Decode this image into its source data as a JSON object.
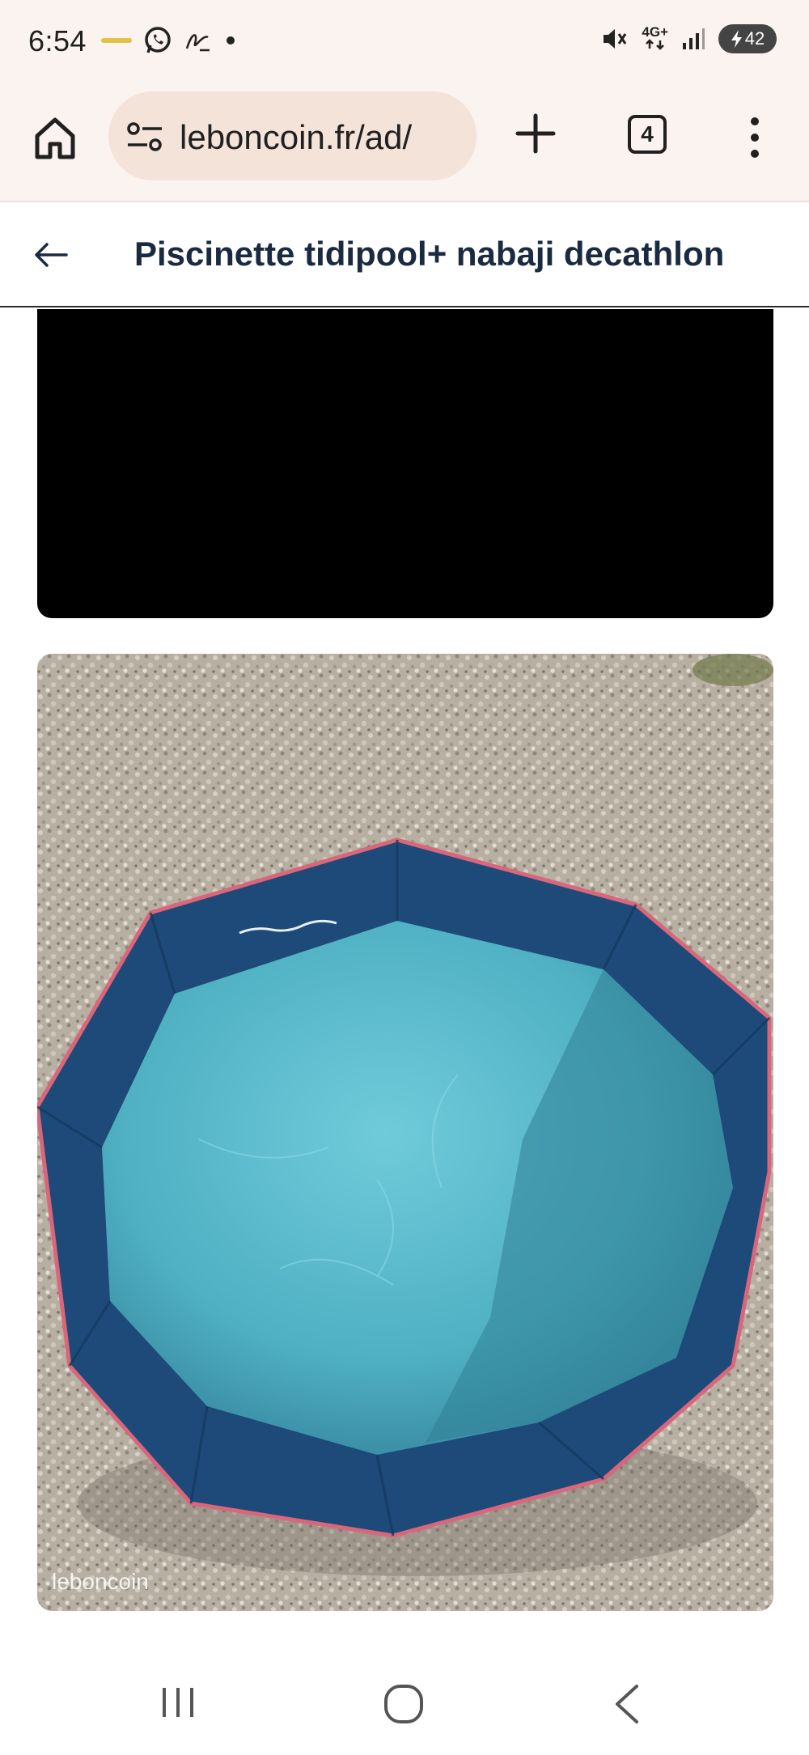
{
  "status_bar": {
    "time": "6:54",
    "network": "4G+",
    "battery": "42",
    "left_icons": [
      "notification-dots-icon",
      "whatsapp-icon",
      "signature-app-icon",
      "dot-icon"
    ],
    "right_icons": [
      "mute-vibrate-icon",
      "network-4g-icon",
      "signal-icon",
      "battery-icon"
    ]
  },
  "browser": {
    "url": "leboncoin.fr/ad/",
    "tab_count": "4",
    "icons": [
      "home-icon",
      "site-settings-icon",
      "new-tab-plus-icon",
      "tabs-icon",
      "more-menu-icon"
    ]
  },
  "page": {
    "title": "Piscinette tidipool+ nabaji decathlon",
    "back_icon": "arrow-left-icon"
  },
  "content": {
    "photo_watermark": "leboncoin",
    "photo_subject": "blue-folding-kiddie-pool-photo"
  },
  "nav": {
    "icons": [
      "recent-apps-icon",
      "home-circle-icon",
      "back-chevron-icon"
    ]
  },
  "colors": {
    "browser_bg": "#fbf3ef",
    "url_bg": "#f4e3d9",
    "title_text": "#1a2a40",
    "pool_wall": "#1f4f7c",
    "pool_floor": "#5ab8c9",
    "gravel": "#b7aea2"
  }
}
